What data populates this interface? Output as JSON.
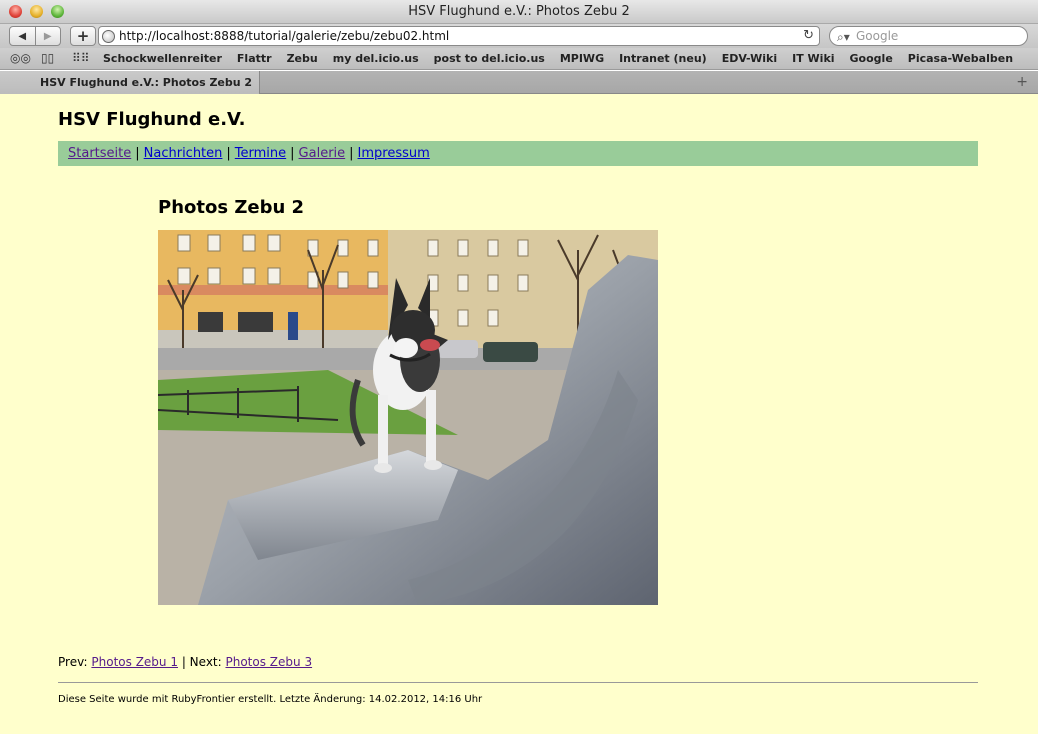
{
  "window": {
    "title": "HSV Flughund e.V.: Photos Zebu 2"
  },
  "toolbar": {
    "url": "http://localhost:8888/tutorial/galerie/zebu/zebu02.html",
    "search_placeholder": "Google"
  },
  "bookmarks": {
    "items": [
      "Schockwellenreiter",
      "Flattr",
      "Zebu",
      "my del.icio.us",
      "post to del.icio.us",
      "MPIWG",
      "Intranet (neu)",
      "EDV-Wiki",
      "IT Wiki",
      "Google",
      "Picasa-Webalben"
    ]
  },
  "tab": {
    "label": "HSV Flughund e.V.: Photos Zebu 2"
  },
  "page": {
    "site_title": "HSV Flughund e.V.",
    "nav": [
      "Startseite",
      "Nachrichten",
      "Termine",
      "Galerie",
      "Impressum"
    ],
    "nav_separator": "|",
    "photo_title": "Photos Zebu 2",
    "prev_label": "Prev:",
    "prev_link": "Photos Zebu 1",
    "next_label": "| Next:",
    "next_link": "Photos Zebu 3",
    "footer": "Diese Seite wurde mit RubyFrontier erstellt. Letzte Änderung: 14.02.2012, 14:16 Uhr"
  },
  "colors": {
    "page_background": "#ffffcc",
    "nav_background": "#99cc99",
    "link": "#0000cc",
    "visited_link": "#551a8b"
  }
}
